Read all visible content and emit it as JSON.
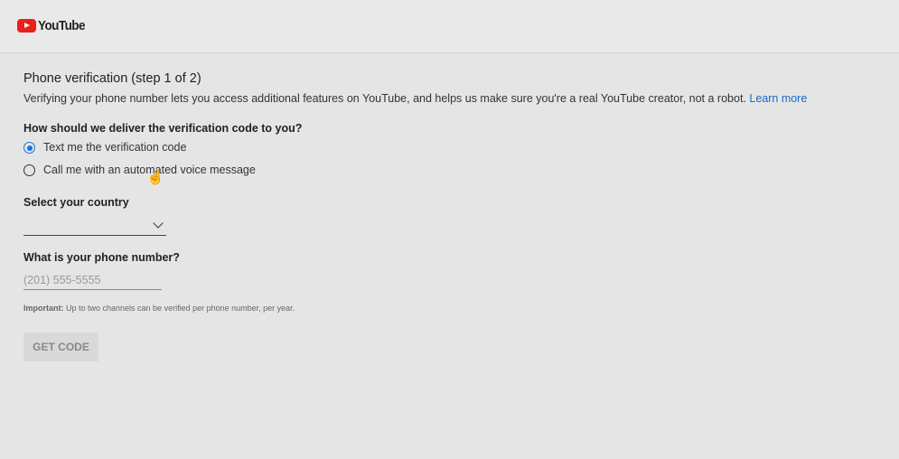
{
  "header": {
    "logo_text": "YouTube"
  },
  "form": {
    "title": "Phone verification (step 1 of 2)",
    "description": "Verifying your phone number lets you access additional features on YouTube, and helps us make sure you're a real YouTube creator, not a robot.",
    "learn_more": "Learn more",
    "delivery_question": "How should we deliver the verification code to you?",
    "options": [
      {
        "label": "Text me the verification code",
        "selected": true
      },
      {
        "label": "Call me with an automated voice message",
        "selected": false
      }
    ],
    "country_label": "Select your country",
    "country_value": "",
    "phone_label": "What is your phone number?",
    "phone_placeholder": "(201) 555-5555",
    "phone_value": "",
    "note_bold": "Important:",
    "note_text": " Up to two channels can be verified per phone number, per year.",
    "get_code": "GET CODE"
  },
  "colors": {
    "accent": "#1a73e8",
    "link": "#1a66c9",
    "brand": "#e62117"
  }
}
